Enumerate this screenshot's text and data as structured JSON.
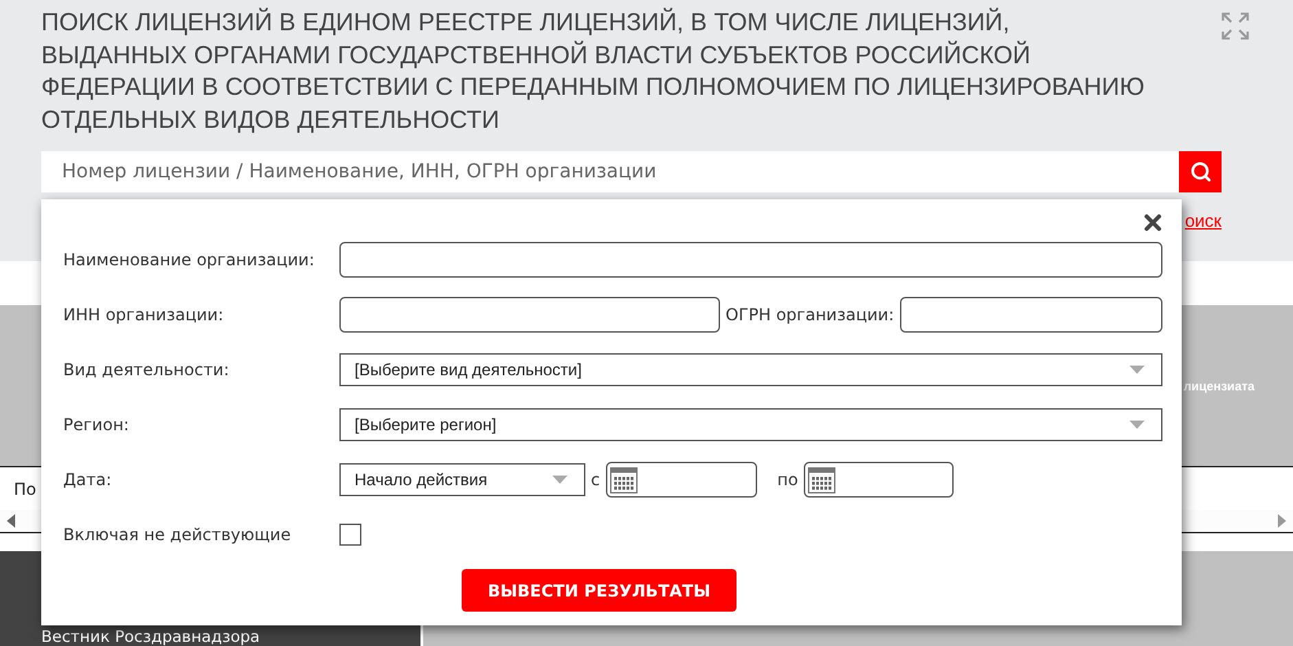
{
  "page_title": "ПОИСК ЛИЦЕНЗИЙ В ЕДИНОМ РЕЕСТРЕ ЛИЦЕНЗИЙ, В ТОМ ЧИСЛЕ ЛИЦЕНЗИЙ, ВЫДАННЫХ ОРГАНАМИ ГОСУДАРСТВЕННОЙ ВЛАСТИ СУБЪЕКТОВ РОССИЙСКОЙ ФЕДЕРАЦИИ В СООТВЕТСТВИИ С ПЕРЕДАННЫМ ПОЛНОМОЧИЕМ ПО ЛИЦЕНЗИРОВАНИЮ ОТДЕЛЬНЫХ ВИДОВ ДЕЯТЕЛЬНОСТИ",
  "search": {
    "placeholder": "Номер лицензии / Наименование, ИНН, ОГРН организации"
  },
  "advanced_search_link": "оиск",
  "table": {
    "column_last": "лицензиата"
  },
  "results_info": "По",
  "footer": {
    "link": "Вестник Росздравнадзора"
  },
  "modal": {
    "rows": [
      {
        "kind": "text",
        "label": "Наименование организации:"
      },
      {
        "kind": "pair",
        "label": "ИНН организации:",
        "second_label": "ОГРН организации:"
      },
      {
        "kind": "select",
        "label": "Вид деятельности:",
        "value": "[Выберите вид деятельности]"
      },
      {
        "kind": "select",
        "label": "Регион:",
        "value": "[Выберите регион]"
      },
      {
        "kind": "date",
        "label": "Дата:",
        "value": "Начало действия",
        "from_label": "с",
        "to_label": "по"
      },
      {
        "kind": "checkbox",
        "label": "Включая не действующие",
        "checked": false
      }
    ],
    "submit": "ВЫВЕСТИ РЕЗУЛЬТАТЫ"
  }
}
